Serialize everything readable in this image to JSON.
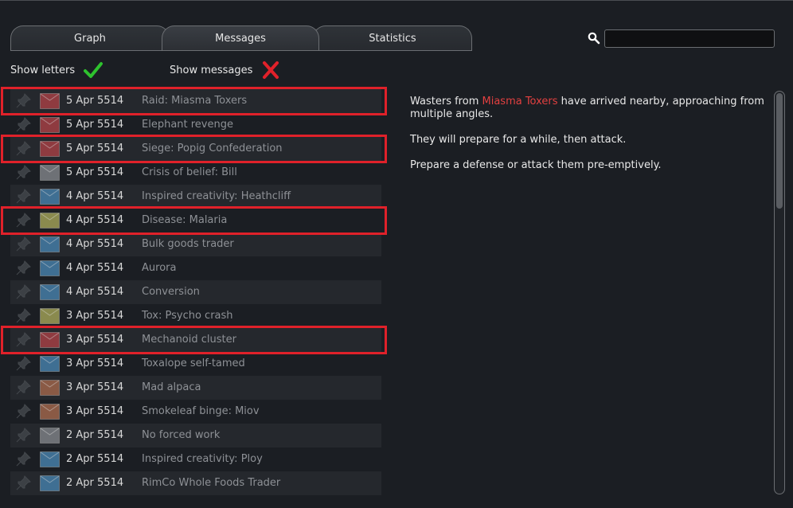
{
  "tabs": [
    {
      "label": "Graph"
    },
    {
      "label": "Messages"
    },
    {
      "label": "Statistics"
    }
  ],
  "search": {
    "value": "",
    "placeholder": ""
  },
  "toggles": {
    "letters": {
      "label": "Show letters",
      "state": "on"
    },
    "messages": {
      "label": "Show messages",
      "state": "off"
    }
  },
  "colors": {
    "check": "#2ec22e",
    "cross": "#e0212a",
    "highlight": "#e0212a",
    "env_red": "#8f3b40",
    "env_grey": "#6e7176",
    "env_blue": "#3f6f93",
    "env_yellow": "#8a8a4e",
    "env_brown": "#8a5a45"
  },
  "letters": [
    {
      "date": "5 Apr 5514",
      "title": "Raid: Miasma Toxers",
      "envelope": "red",
      "highlighted": true
    },
    {
      "date": "5 Apr 5514",
      "title": "Elephant revenge",
      "envelope": "red",
      "highlighted": false
    },
    {
      "date": "5 Apr 5514",
      "title": "Siege: Popig Confederation",
      "envelope": "red",
      "highlighted": true
    },
    {
      "date": "5 Apr 5514",
      "title": "Crisis of belief: Bill",
      "envelope": "grey",
      "highlighted": false
    },
    {
      "date": "4 Apr 5514",
      "title": "Inspired creativity: Heathcliff",
      "envelope": "blue",
      "highlighted": false
    },
    {
      "date": "4 Apr 5514",
      "title": "Disease: Malaria",
      "envelope": "yellow",
      "highlighted": true
    },
    {
      "date": "4 Apr 5514",
      "title": "Bulk goods trader",
      "envelope": "blue",
      "highlighted": false
    },
    {
      "date": "4 Apr 5514",
      "title": "Aurora",
      "envelope": "blue",
      "highlighted": false
    },
    {
      "date": "4 Apr 5514",
      "title": "Conversion",
      "envelope": "blue",
      "highlighted": false
    },
    {
      "date": "3 Apr 5514",
      "title": "Tox: Psycho crash",
      "envelope": "yellow",
      "highlighted": false
    },
    {
      "date": "3 Apr 5514",
      "title": "Mechanoid cluster",
      "envelope": "red",
      "highlighted": true
    },
    {
      "date": "3 Apr 5514",
      "title": "Toxalope self-tamed",
      "envelope": "blue",
      "highlighted": false
    },
    {
      "date": "3 Apr 5514",
      "title": "Mad alpaca",
      "envelope": "brown",
      "highlighted": false
    },
    {
      "date": "3 Apr 5514",
      "title": "Smokeleaf binge: Miov",
      "envelope": "brown",
      "highlighted": false
    },
    {
      "date": "2 Apr 5514",
      "title": "No forced work",
      "envelope": "grey",
      "highlighted": false
    },
    {
      "date": "2 Apr 5514",
      "title": "Inspired creativity: Ploy",
      "envelope": "blue",
      "highlighted": false
    },
    {
      "date": "2 Apr 5514",
      "title": "RimCo Whole Foods Trader",
      "envelope": "blue",
      "highlighted": false
    }
  ],
  "detail": {
    "line1_pre": "Wasters from ",
    "line1_faction": "Miasma Toxers",
    "line1_post": " have arrived nearby, approaching from multiple angles.",
    "line2": "They will prepare for a while, then attack.",
    "line3": "Prepare a defense or attack them pre-emptively."
  }
}
